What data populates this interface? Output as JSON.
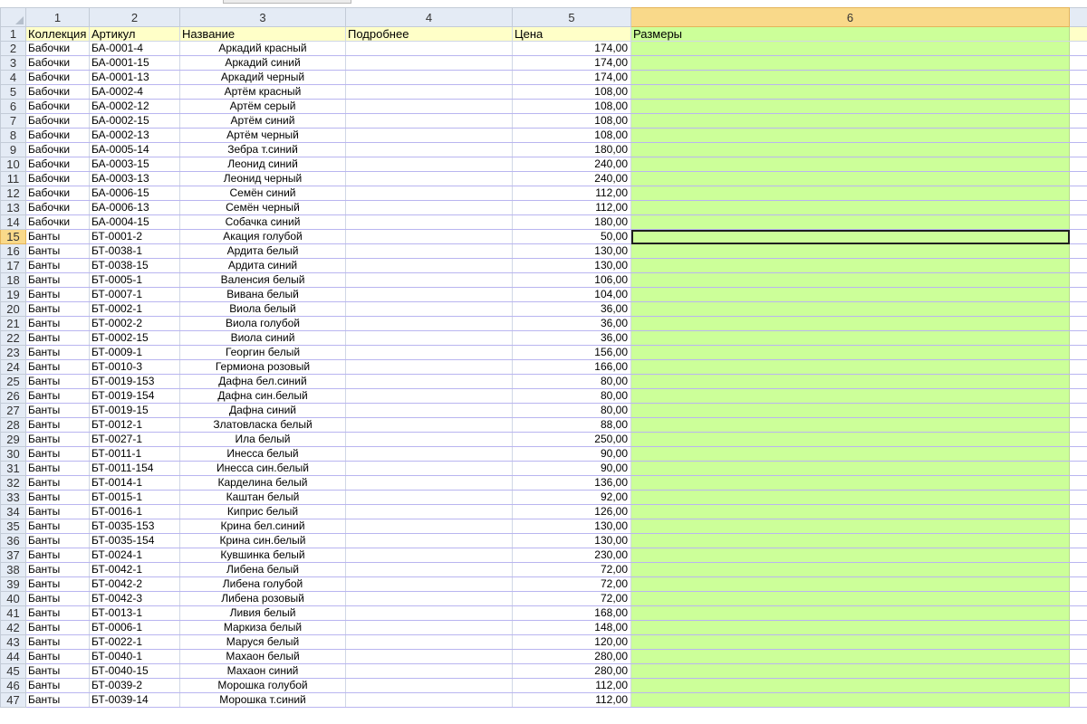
{
  "column_headers": [
    "1",
    "2",
    "3",
    "4",
    "5",
    "6"
  ],
  "selected_column": 5,
  "active_row": 15,
  "header_row": {
    "row_number": "1",
    "cells": [
      "Коллекция",
      "Артикул",
      "Название",
      "Подробнее",
      "Цена",
      "Размеры"
    ]
  },
  "rows": [
    {
      "n": "2",
      "cells": [
        "Бабочки",
        "БА-0001-4",
        "Аркадий красный",
        "",
        "174,00",
        ""
      ]
    },
    {
      "n": "3",
      "cells": [
        "Бабочки",
        "БА-0001-15",
        "Аркадий синий",
        "",
        "174,00",
        ""
      ]
    },
    {
      "n": "4",
      "cells": [
        "Бабочки",
        "БА-0001-13",
        "Аркадий черный",
        "",
        "174,00",
        ""
      ]
    },
    {
      "n": "5",
      "cells": [
        "Бабочки",
        "БА-0002-4",
        "Артём красный",
        "",
        "108,00",
        ""
      ]
    },
    {
      "n": "6",
      "cells": [
        "Бабочки",
        "БА-0002-12",
        "Артём серый",
        "",
        "108,00",
        ""
      ]
    },
    {
      "n": "7",
      "cells": [
        "Бабочки",
        "БА-0002-15",
        "Артём синий",
        "",
        "108,00",
        ""
      ]
    },
    {
      "n": "8",
      "cells": [
        "Бабочки",
        "БА-0002-13",
        "Артём черный",
        "",
        "108,00",
        ""
      ]
    },
    {
      "n": "9",
      "cells": [
        "Бабочки",
        "БА-0005-14",
        "Зебра т.синий",
        "",
        "180,00",
        ""
      ]
    },
    {
      "n": "10",
      "cells": [
        "Бабочки",
        "БА-0003-15",
        "Леонид синий",
        "",
        "240,00",
        ""
      ]
    },
    {
      "n": "11",
      "cells": [
        "Бабочки",
        "БА-0003-13",
        "Леонид черный",
        "",
        "240,00",
        ""
      ]
    },
    {
      "n": "12",
      "cells": [
        "Бабочки",
        "БА-0006-15",
        "Семён синий",
        "",
        "112,00",
        ""
      ]
    },
    {
      "n": "13",
      "cells": [
        "Бабочки",
        "БА-0006-13",
        "Семён черный",
        "",
        "112,00",
        ""
      ]
    },
    {
      "n": "14",
      "cells": [
        "Бабочки",
        "БА-0004-15",
        "Собачка синий",
        "",
        "180,00",
        ""
      ]
    },
    {
      "n": "15",
      "cells": [
        "Банты",
        "БТ-0001-2",
        "Акация голубой",
        "",
        "50,00",
        ""
      ]
    },
    {
      "n": "16",
      "cells": [
        "Банты",
        "БТ-0038-1",
        "Ардита белый",
        "",
        "130,00",
        ""
      ]
    },
    {
      "n": "17",
      "cells": [
        "Банты",
        "БТ-0038-15",
        "Ардита синий",
        "",
        "130,00",
        ""
      ]
    },
    {
      "n": "18",
      "cells": [
        "Банты",
        "БТ-0005-1",
        "Валенсия белый",
        "",
        "106,00",
        ""
      ]
    },
    {
      "n": "19",
      "cells": [
        "Банты",
        "БТ-0007-1",
        "Вивана белый",
        "",
        "104,00",
        ""
      ]
    },
    {
      "n": "20",
      "cells": [
        "Банты",
        "БТ-0002-1",
        "Виола белый",
        "",
        "36,00",
        ""
      ]
    },
    {
      "n": "21",
      "cells": [
        "Банты",
        "БТ-0002-2",
        "Виола голубой",
        "",
        "36,00",
        ""
      ]
    },
    {
      "n": "22",
      "cells": [
        "Банты",
        "БТ-0002-15",
        "Виола синий",
        "",
        "36,00",
        ""
      ]
    },
    {
      "n": "23",
      "cells": [
        "Банты",
        "БТ-0009-1",
        "Георгин белый",
        "",
        "156,00",
        ""
      ]
    },
    {
      "n": "24",
      "cells": [
        "Банты",
        "БТ-0010-3",
        "Гермиона розовый",
        "",
        "166,00",
        ""
      ]
    },
    {
      "n": "25",
      "cells": [
        "Банты",
        "БТ-0019-153",
        "Дафна бел.синий",
        "",
        "80,00",
        ""
      ]
    },
    {
      "n": "26",
      "cells": [
        "Банты",
        "БТ-0019-154",
        "Дафна син.белый",
        "",
        "80,00",
        ""
      ]
    },
    {
      "n": "27",
      "cells": [
        "Банты",
        "БТ-0019-15",
        "Дафна синий",
        "",
        "80,00",
        ""
      ]
    },
    {
      "n": "28",
      "cells": [
        "Банты",
        "БТ-0012-1",
        "Златовласка белый",
        "",
        "88,00",
        ""
      ]
    },
    {
      "n": "29",
      "cells": [
        "Банты",
        "БТ-0027-1",
        "Ила белый",
        "",
        "250,00",
        ""
      ]
    },
    {
      "n": "30",
      "cells": [
        "Банты",
        "БТ-0011-1",
        "Инесса белый",
        "",
        "90,00",
        ""
      ]
    },
    {
      "n": "31",
      "cells": [
        "Банты",
        "БТ-0011-154",
        "Инесса син.белый",
        "",
        "90,00",
        ""
      ]
    },
    {
      "n": "32",
      "cells": [
        "Банты",
        "БТ-0014-1",
        "Карделина белый",
        "",
        "136,00",
        ""
      ]
    },
    {
      "n": "33",
      "cells": [
        "Банты",
        "БТ-0015-1",
        "Каштан белый",
        "",
        "92,00",
        ""
      ]
    },
    {
      "n": "34",
      "cells": [
        "Банты",
        "БТ-0016-1",
        "Киприс белый",
        "",
        "126,00",
        ""
      ]
    },
    {
      "n": "35",
      "cells": [
        "Банты",
        "БТ-0035-153",
        "Крина бел.синий",
        "",
        "130,00",
        ""
      ]
    },
    {
      "n": "36",
      "cells": [
        "Банты",
        "БТ-0035-154",
        "Крина син.белый",
        "",
        "130,00",
        ""
      ]
    },
    {
      "n": "37",
      "cells": [
        "Банты",
        "БТ-0024-1",
        "Кувшинка белый",
        "",
        "230,00",
        ""
      ]
    },
    {
      "n": "38",
      "cells": [
        "Банты",
        "БТ-0042-1",
        "Либена белый",
        "",
        "72,00",
        ""
      ]
    },
    {
      "n": "39",
      "cells": [
        "Банты",
        "БТ-0042-2",
        "Либена голубой",
        "",
        "72,00",
        ""
      ]
    },
    {
      "n": "40",
      "cells": [
        "Банты",
        "БТ-0042-3",
        "Либена розовый",
        "",
        "72,00",
        ""
      ]
    },
    {
      "n": "41",
      "cells": [
        "Банты",
        "БТ-0013-1",
        "Ливия белый",
        "",
        "168,00",
        ""
      ]
    },
    {
      "n": "42",
      "cells": [
        "Банты",
        "БТ-0006-1",
        "Маркиза белый",
        "",
        "148,00",
        ""
      ]
    },
    {
      "n": "43",
      "cells": [
        "Банты",
        "БТ-0022-1",
        "Маруся белый",
        "",
        "120,00",
        ""
      ]
    },
    {
      "n": "44",
      "cells": [
        "Банты",
        "БТ-0040-1",
        "Махаон белый",
        "",
        "280,00",
        ""
      ]
    },
    {
      "n": "45",
      "cells": [
        "Банты",
        "БТ-0040-15",
        "Махаон синий",
        "",
        "280,00",
        ""
      ]
    },
    {
      "n": "46",
      "cells": [
        "Банты",
        "БТ-0039-2",
        "Морошка голубой",
        "",
        "112,00",
        ""
      ]
    },
    {
      "n": "47",
      "cells": [
        "Банты",
        "БТ-0039-14",
        "Морошка т.синий",
        "",
        "112,00",
        ""
      ]
    }
  ],
  "colors": {
    "header_fill": "#ffffc8",
    "size_column_fill": "#ccff99",
    "selected_header": "#f9d98a",
    "row_border": "#b9b5f0"
  }
}
